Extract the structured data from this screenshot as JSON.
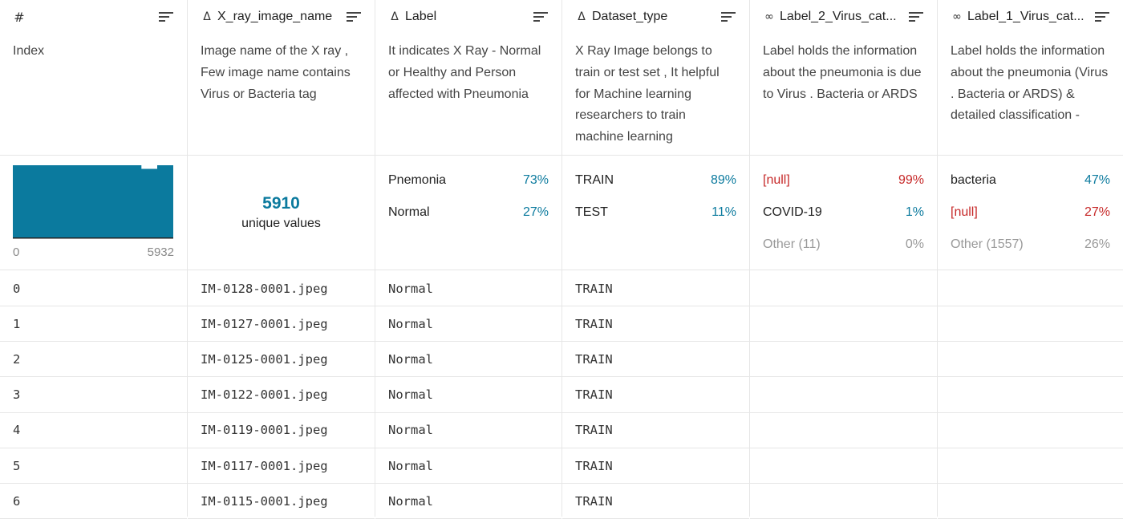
{
  "columns": [
    {
      "name": "#",
      "type_icon": "number-type-icon",
      "description": "Index"
    },
    {
      "name": "X_ray_image_name",
      "type_icon": "string-type-icon",
      "description": "Image name of the X ray , Few image name contains Virus or Bacteria tag"
    },
    {
      "name": "Label",
      "type_icon": "string-type-icon",
      "description": "It indicates X Ray - Normal or Healthy and Person affected with Pneumonia"
    },
    {
      "name": "Dataset_type",
      "type_icon": "string-type-icon",
      "description": "X Ray Image belongs to train or test set , It helpful for Machine learning researchers to train machine learning"
    },
    {
      "name": "Label_2_Virus_cat...",
      "type_icon": "link-type-icon",
      "description": "Label holds the information about the pneumonia is due to Virus . Bacteria or ARDS"
    },
    {
      "name": "Label_1_Virus_cat...",
      "type_icon": "link-type-icon",
      "description": "Label holds the information about the pneumonia (Virus . Bacteria or ARDS) & detailed classification -"
    }
  ],
  "summaries": {
    "index": {
      "min_label": "0",
      "max_label": "5932",
      "histogram": [
        1,
        1,
        1,
        1,
        1,
        1,
        1,
        1,
        0.95,
        1
      ]
    },
    "image_name": {
      "unique_count": "5910",
      "unique_label": "unique values"
    },
    "label": [
      {
        "label": "Pnemonia",
        "pct": "73%",
        "kind": "value"
      },
      {
        "label": "Normal",
        "pct": "27%",
        "kind": "value"
      }
    ],
    "dataset_type": [
      {
        "label": "TRAIN",
        "pct": "89%",
        "kind": "value"
      },
      {
        "label": "TEST",
        "pct": "11%",
        "kind": "value"
      }
    ],
    "label_2": [
      {
        "label": "[null]",
        "pct": "99%",
        "kind": "null"
      },
      {
        "label": "COVID-19",
        "pct": "1%",
        "kind": "value"
      },
      {
        "label": "Other (11)",
        "pct": "0%",
        "kind": "other"
      }
    ],
    "label_1": [
      {
        "label": "bacteria",
        "pct": "47%",
        "kind": "value"
      },
      {
        "label": "[null]",
        "pct": "27%",
        "kind": "null"
      },
      {
        "label": "Other (1557)",
        "pct": "26%",
        "kind": "other"
      }
    ]
  },
  "rows": [
    {
      "index": "0",
      "image": "IM-0128-0001.jpeg",
      "label": "Normal",
      "dataset": "TRAIN",
      "label_2": "",
      "label_1": ""
    },
    {
      "index": "1",
      "image": "IM-0127-0001.jpeg",
      "label": "Normal",
      "dataset": "TRAIN",
      "label_2": "",
      "label_1": ""
    },
    {
      "index": "2",
      "image": "IM-0125-0001.jpeg",
      "label": "Normal",
      "dataset": "TRAIN",
      "label_2": "",
      "label_1": ""
    },
    {
      "index": "3",
      "image": "IM-0122-0001.jpeg",
      "label": "Normal",
      "dataset": "TRAIN",
      "label_2": "",
      "label_1": ""
    },
    {
      "index": "4",
      "image": "IM-0119-0001.jpeg",
      "label": "Normal",
      "dataset": "TRAIN",
      "label_2": "",
      "label_1": ""
    },
    {
      "index": "5",
      "image": "IM-0117-0001.jpeg",
      "label": "Normal",
      "dataset": "TRAIN",
      "label_2": "",
      "label_1": ""
    },
    {
      "index": "6",
      "image": "IM-0115-0001.jpeg",
      "label": "Normal",
      "dataset": "TRAIN",
      "label_2": "",
      "label_1": ""
    }
  ],
  "colors": {
    "accent": "#0b7a9e",
    "null": "#c62828",
    "muted": "#999999"
  }
}
